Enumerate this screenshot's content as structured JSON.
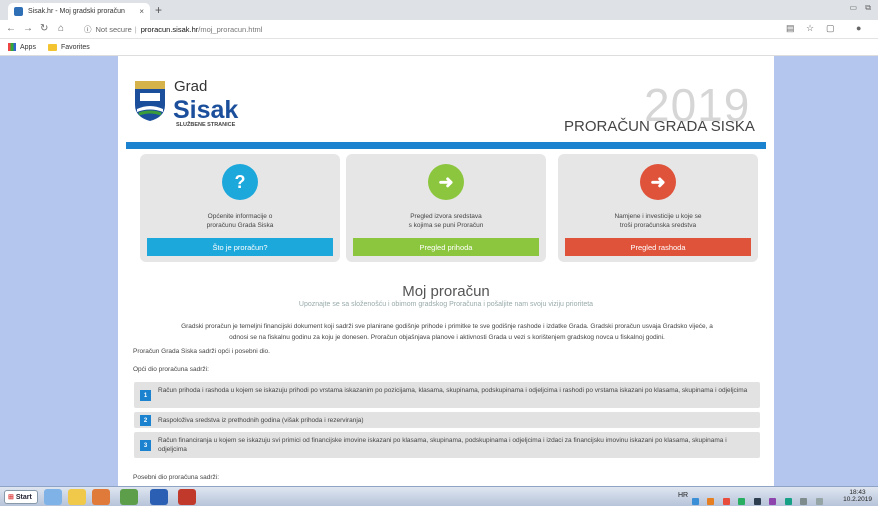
{
  "browser": {
    "tab_title": "Sisak.hr - Moj gradski proračun",
    "tab_close": "×",
    "new_tab": "+",
    "security": "Not secure",
    "url_host": "proracun.sisak.hr",
    "url_path": "/moj_proracun.html"
  },
  "bookmarks": {
    "apps": "Apps",
    "favorites": "Favorites"
  },
  "site": {
    "logo_grad": "Grad",
    "logo_sisak": "Sisak",
    "logo_sub": "SLUŽBENE STRANICE",
    "hero_year": "2019",
    "hero_title": "PRORAČUN GRADA SISKA"
  },
  "cards": [
    {
      "icon": "question-icon",
      "symbol": "?",
      "text1": "Općenite informacije o",
      "text2": "proračunu Grada Siska",
      "button": "Što je proračun?",
      "color": "#1da8dc"
    },
    {
      "icon": "sign-in-icon",
      "symbol": "➜",
      "text1": "Pregled izvora sredstava",
      "text2": "s kojima se puni Proračun",
      "button": "Pregled prihoda",
      "color": "#8cc63e"
    },
    {
      "icon": "sign-out-icon",
      "symbol": "➜",
      "text1": "Namjene i investicije u koje se",
      "text2": "troši proračunska sredstva",
      "button": "Pregled rashoda",
      "color": "#e0533b"
    }
  ],
  "main": {
    "title": "Moj proračun",
    "subtitle": "Upoznajte se sa složenošću i obimom gradskog Proračuna i pošaljite nam svoju viziju prioriteta",
    "intro1": "Gradski proračun je temeljni financijski dokument koji sadrži sve planirane godišnje prihode i primitke te sve godišnje rashode i izdatke Grada. Gradski proračun usvaja Gradsko vijeće, a",
    "intro2": "odnosi se na fiskalnu godinu za koju je donesen. Proračun objašnjava planove i aktivnosti Grada u vezi s korištenjem gradskog novca u fiskalnoj godini.",
    "p1": "Proračun Grada Siska sadrži opći i posebni dio.",
    "p2": "Opći dio proračuna sadrži:",
    "items": [
      {
        "num": "1",
        "text": "Račun prihoda i rashoda u kojem se iskazuju prihodi po vrstama iskazanim po pozicijama, klasama, skupinama, podskupinama i odjeljcima i rashodi po vrstama iskazani po klasama, skupinama i odjeljcima"
      },
      {
        "num": "2",
        "text": "Raspoloživa sredstva iz prethodnih godina (višak prihoda i rezerviranja)"
      },
      {
        "num": "3",
        "text": "Račun financiranja u kojem se iskazuju svi primici od financijske imovine iskazani po klasama, skupinama, podskupinama i odjeljcima i izdaci za financijsku imovinu iskazani po klasama, skupinama i odjeljcima"
      }
    ],
    "p3": "Posebni dio proračuna sadrži:"
  },
  "taskbar": {
    "start": "Start",
    "lang": "HR",
    "time": "18:43",
    "date": "10.2.2019"
  }
}
